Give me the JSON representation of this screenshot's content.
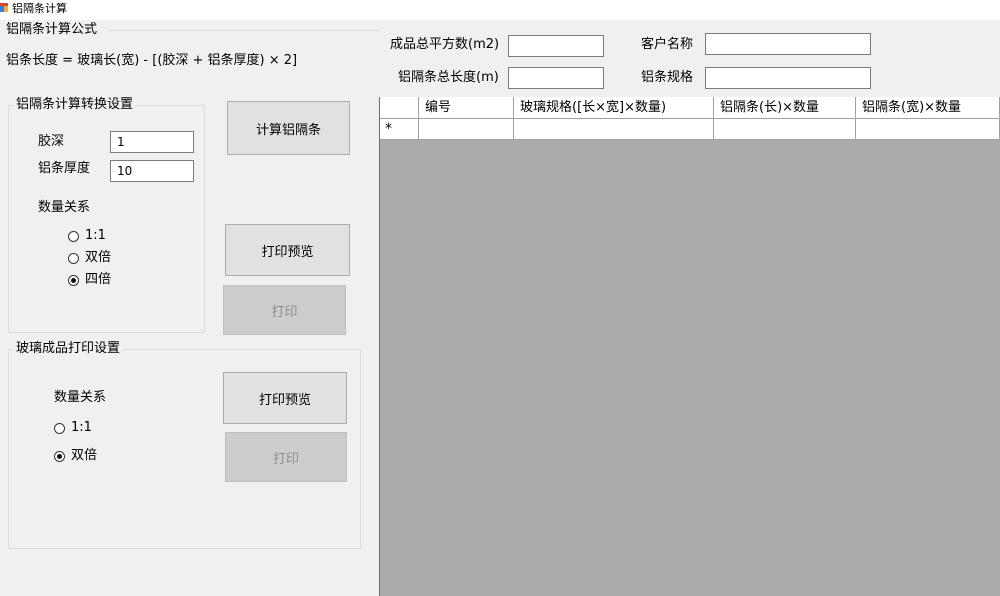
{
  "window": {
    "title": "铝隔条计算"
  },
  "formula_section": {
    "title": "铝隔条计算公式",
    "formula": "铝条长度 = 玻璃长(宽) - [(胶深 + 铝条厚度) × 2]"
  },
  "summary": {
    "total_area_label": "成品总平方数(m2)",
    "total_area_value": "",
    "total_length_label": "铝隔条总长度(m)",
    "total_length_value": "",
    "customer_label": "客户名称",
    "customer_value": "",
    "spec_label": "铝条规格",
    "spec_value": ""
  },
  "conversion_settings": {
    "title": "铝隔条计算转换设置",
    "glue_depth_label": "胶深",
    "glue_depth_value": "1",
    "thickness_label": "铝条厚度",
    "thickness_value": "10",
    "quantity_label": "数量关系",
    "options": [
      {
        "label": "1:1",
        "checked": false
      },
      {
        "label": "双倍",
        "checked": false
      },
      {
        "label": "四倍",
        "checked": true
      }
    ]
  },
  "buttons": {
    "calculate": "计算铝隔条",
    "preview1": "打印预览",
    "print1": "打印",
    "preview2": "打印预览",
    "print2": "打印"
  },
  "glass_print_settings": {
    "title": "玻璃成品打印设置",
    "quantity_label": "数量关系",
    "options": [
      {
        "label": "1:1",
        "checked": false
      },
      {
        "label": "双倍",
        "checked": true
      }
    ]
  },
  "grid": {
    "columns": [
      "编号",
      "玻璃规格([长×宽]×数量)",
      "铝隔条(长)×数量",
      "铝隔条(宽)×数量"
    ],
    "new_row_marker": "*"
  },
  "colors": {
    "grid_background": "#ababab",
    "window_background": "#f0f0f0",
    "disabled_button": "#cccccc"
  }
}
